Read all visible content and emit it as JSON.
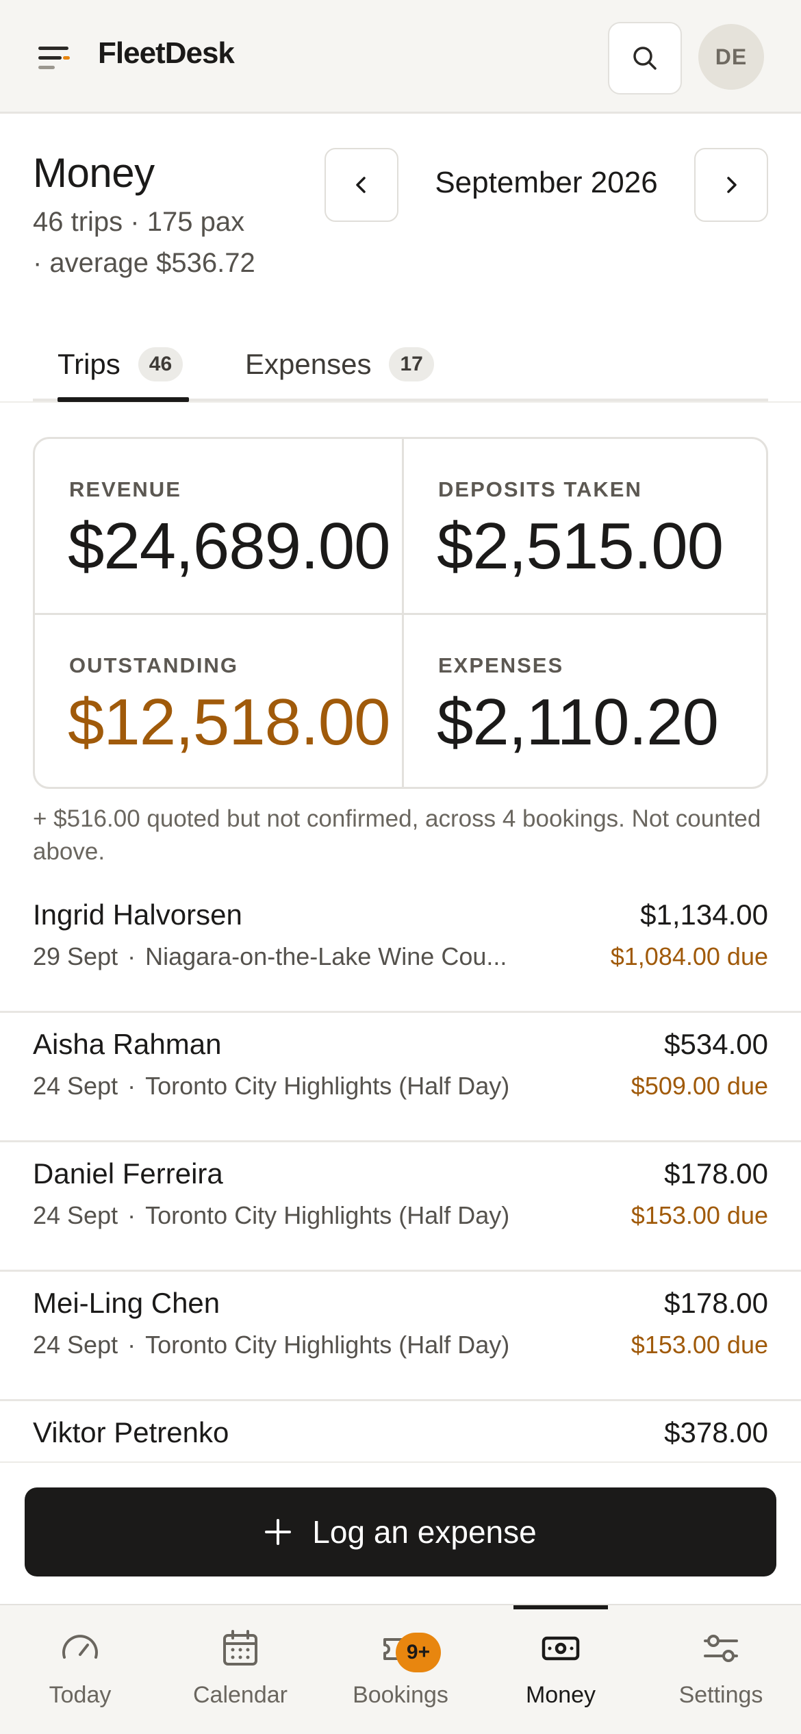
{
  "app": {
    "name": "FleetDesk",
    "user_initials": "DE"
  },
  "page": {
    "title": "Money",
    "summary_line1": "46 trips · 175 pax",
    "summary_line2": "· average $536.72",
    "month": "September 2026"
  },
  "tabs": [
    {
      "label": "Trips",
      "count": "46",
      "active": true
    },
    {
      "label": "Expenses",
      "count": "17",
      "active": false
    }
  ],
  "stats": [
    {
      "label": "REVENUE",
      "value": "$24,689.00"
    },
    {
      "label": "DEPOSITS TAKEN",
      "value": "$2,515.00"
    },
    {
      "label": "OUTSTANDING",
      "value": "$12,518.00"
    },
    {
      "label": "EXPENSES",
      "value": "$2,110.20"
    }
  ],
  "quote_note": "+ $516.00 quoted but not confirmed, across 4 bookings. Not counted above.",
  "trips": [
    {
      "name": "Ingrid Halvorsen",
      "amount": "$1,134.00",
      "date": "29 Sept",
      "tour": "Niagara-on-the-Lake Wine Cou...",
      "due": "$1,084.00 due"
    },
    {
      "name": "Aisha Rahman",
      "amount": "$534.00",
      "date": "24 Sept",
      "tour": "Toronto City Highlights (Half Day)",
      "due": "$509.00 due"
    },
    {
      "name": "Daniel Ferreira",
      "amount": "$178.00",
      "date": "24 Sept",
      "tour": "Toronto City Highlights (Half Day)",
      "due": "$153.00 due"
    },
    {
      "name": "Mei-Ling Chen",
      "amount": "$178.00",
      "date": "24 Sept",
      "tour": "Toronto City Highlights (Half Day)",
      "due": "$153.00 due"
    },
    {
      "name": "Viktor Petrenko",
      "amount": "$378.00"
    }
  ],
  "action": {
    "log_expense_label": "Log an expense"
  },
  "bottom_nav": [
    {
      "label": "Today",
      "icon": "gauge-icon"
    },
    {
      "label": "Calendar",
      "icon": "calendar-icon"
    },
    {
      "label": "Bookings",
      "icon": "ticket-icon",
      "badge": "9+"
    },
    {
      "label": "Money",
      "icon": "banknote-icon",
      "active": true
    },
    {
      "label": "Settings",
      "icon": "sliders-icon"
    }
  ],
  "colors": {
    "accent_due": "#a05a0a",
    "badge": "#e8860f",
    "primary_button": "#1b1a19"
  }
}
